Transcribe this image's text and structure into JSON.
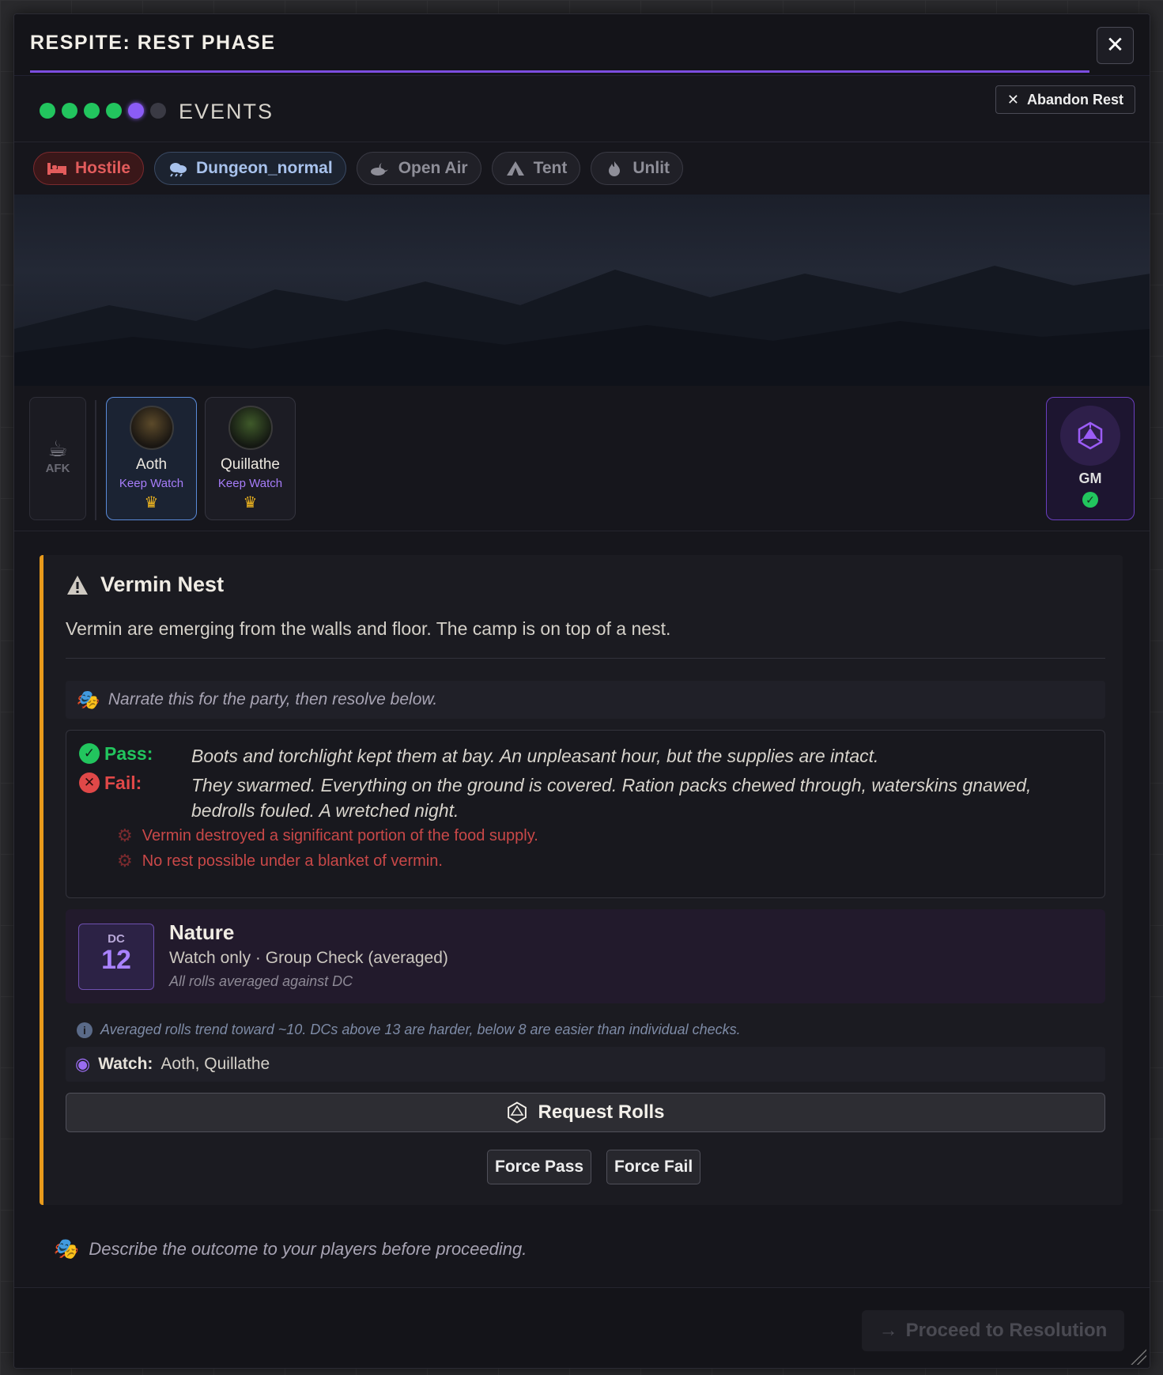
{
  "window": {
    "title": "RESPITE: REST PHASE",
    "close_glyph": "✕"
  },
  "phase": {
    "label": "EVENTS",
    "steps": [
      "done",
      "done",
      "done",
      "done",
      "current",
      "pending"
    ],
    "abandon_label": "Abandon Rest"
  },
  "tags": [
    {
      "label": "Hostile",
      "icon": "bed-icon"
    },
    {
      "label": "Dungeon_normal",
      "icon": "cloud-icon"
    },
    {
      "label": "Open Air",
      "icon": "sky-icon"
    },
    {
      "label": "Tent",
      "icon": "tent-icon"
    },
    {
      "label": "Unlit",
      "icon": "flame-icon"
    }
  ],
  "party": {
    "afk_label": "AFK",
    "members": [
      {
        "name": "Aoth",
        "role": "Keep Watch",
        "crown": "♛",
        "selected": true
      },
      {
        "name": "Quillathe",
        "role": "Keep Watch",
        "crown": "♛",
        "selected": false
      }
    ],
    "gm": {
      "label": "GM",
      "ready": true
    }
  },
  "event": {
    "title": "Vermin Nest",
    "description": "Vermin are emerging from the walls and floor. The camp is on top of a nest.",
    "narrate": "Narrate this for the party, then resolve below.",
    "pass_label": "Pass:",
    "pass_text": "Boots and torchlight kept them at bay. An unpleasant hour, but the supplies are intact.",
    "fail_label": "Fail:",
    "fail_text": "They swarmed. Everything on the ground is covered. Ration packs chewed through, waterskins gnawed, bedrolls fouled. A wretched night.",
    "consequences": [
      "Vermin destroyed a significant portion of the food supply.",
      "No rest possible under a blanket of vermin."
    ],
    "check": {
      "dc_label": "DC",
      "dc_value": "12",
      "skill": "Nature",
      "subtitle": "Watch only · Group Check (averaged)",
      "note": "All rolls averaged against DC"
    },
    "hint": "Averaged rolls trend toward ~10. DCs above 13 are harder, below 8 are easier than individual checks.",
    "watch_label": "Watch:",
    "watch_names": "Aoth, Quillathe",
    "request_label": "Request Rolls",
    "force_pass_label": "Force Pass",
    "force_fail_label": "Force Fail"
  },
  "describe": "Describe the outcome to your players before proceeding.",
  "proceed_label": "Proceed to Resolution",
  "colors": {
    "accent": "#7c4ddf",
    "pass": "#22c55e",
    "fail": "#e04848",
    "event_border": "#e89a1b"
  }
}
